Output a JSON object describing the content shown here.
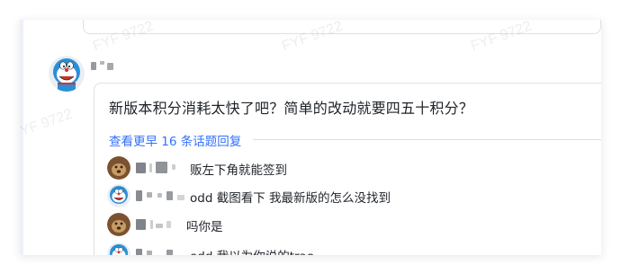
{
  "watermark": "FYF 9722",
  "thread": {
    "message": "新版本积分消耗太快了吧？简单的改动就要四五十积分？",
    "more_replies": "查看更早 16 条话题回复",
    "replies": [
      {
        "text": "贩左下角就能签到",
        "avatar": "dog-avatar"
      },
      {
        "text": "odd 截图看下 我最新版的怎么没找到",
        "avatar": "doraemon-avatar"
      },
      {
        "text": "吗你是",
        "avatar": "dog-avatar"
      },
      {
        "text": "odd 我以为你说的trae",
        "avatar": "doraemon-avatar"
      }
    ]
  },
  "colors": {
    "link": "#3370ff",
    "text": "#1f2329",
    "border": "#dee0e3"
  }
}
